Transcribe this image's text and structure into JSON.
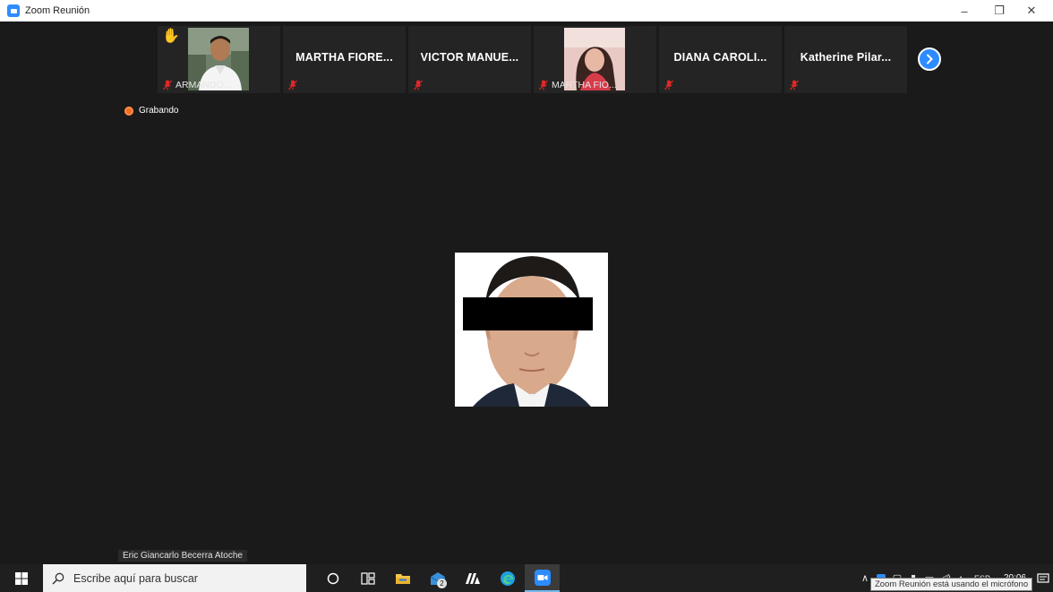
{
  "window": {
    "title": "Zoom Reunión",
    "minimize_glyph": "–",
    "restore_glyph": "❐",
    "close_glyph": "✕"
  },
  "participants": [
    {
      "name": "ARMANDO...",
      "has_photo": true,
      "hand_raised": true,
      "muted": true,
      "photo_label": "ARMANDO..."
    },
    {
      "name": "MARTHA FIORE...",
      "has_photo": false,
      "muted": true
    },
    {
      "name": "VICTOR MANUE...",
      "has_photo": false,
      "muted": true
    },
    {
      "name": "MARTHA FIO...",
      "has_photo": true,
      "muted": true,
      "photo_label": "MARTHA FIO..."
    },
    {
      "name": "DIANA CAROLI...",
      "has_photo": false,
      "muted": true
    },
    {
      "name": "Katherine Pilar...",
      "has_photo": false,
      "muted": true
    }
  ],
  "recording": {
    "label": "Grabando"
  },
  "active_speaker": {
    "name": "Eric Giancarlo Becerra Atoche"
  },
  "taskbar": {
    "search_placeholder": "Escribe aquí para buscar",
    "mail_badge": "2",
    "clock_time": "20:06",
    "tray_lang": "ESP",
    "tooltip": "Zoom Reunión está usando el micrófono"
  },
  "colors": {
    "zoom_blue": "#2d8cff",
    "meeting_bg": "#1a1a1a",
    "tile_bg": "#242424",
    "muted_red": "#e02828",
    "recording_orange": "#f26d21"
  }
}
